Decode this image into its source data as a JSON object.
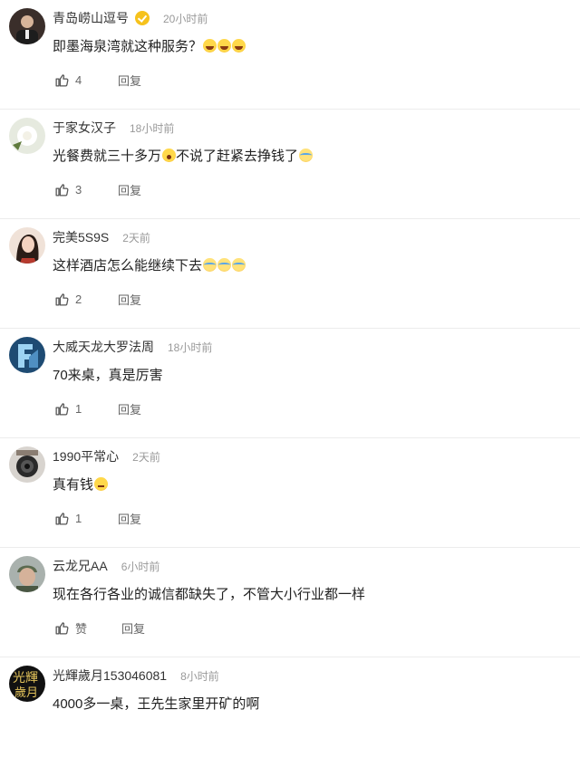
{
  "comments": [
    {
      "username": "青岛崂山逗号",
      "verified": true,
      "time": "20小时前",
      "text": "即墨海泉湾就这种服务？",
      "emoji": [
        "laugh",
        "laugh",
        "laugh"
      ],
      "likes": "4",
      "reply": "回复"
    },
    {
      "username": "于家女汉子",
      "verified": false,
      "time": "18小时前",
      "text": "光餐费就三十多万",
      "emoji_mid": "shock",
      "text2": "不说了赶紧去挣钱了",
      "emoji": [
        "cry"
      ],
      "likes": "3",
      "reply": "回复"
    },
    {
      "username": "完美5S9S",
      "verified": false,
      "time": "2天前",
      "text": "这样酒店怎么能继续下去",
      "emoji": [
        "cry",
        "cry",
        "cry"
      ],
      "likes": "2",
      "reply": "回复"
    },
    {
      "username": "大威天龙大罗法周",
      "verified": false,
      "time": "18小时前",
      "text": "70来桌，真是厉害",
      "emoji": [],
      "likes": "1",
      "reply": "回复"
    },
    {
      "username": "1990平常心",
      "verified": false,
      "time": "2天前",
      "text": "真有钱",
      "emoji": [
        "think"
      ],
      "likes": "1",
      "reply": "回复"
    },
    {
      "username": "云龙兄AA",
      "verified": false,
      "time": "6小时前",
      "text": "现在各行各业的诚信都缺失了，不管大小行业都一样",
      "emoji": [],
      "likes": "赞",
      "reply": "回复"
    },
    {
      "username": "光輝歲月153046081",
      "verified": false,
      "time": "8小时前",
      "text": "4000多一桌，王先生家里开矿的啊",
      "emoji": [],
      "likes": "",
      "reply": ""
    }
  ],
  "icons": {
    "like": "thumbs-up-icon",
    "verified": "verified-badge-icon"
  },
  "colors": {
    "verified": "#f6c21c",
    "meta": "#999999",
    "divider": "#ececec"
  }
}
